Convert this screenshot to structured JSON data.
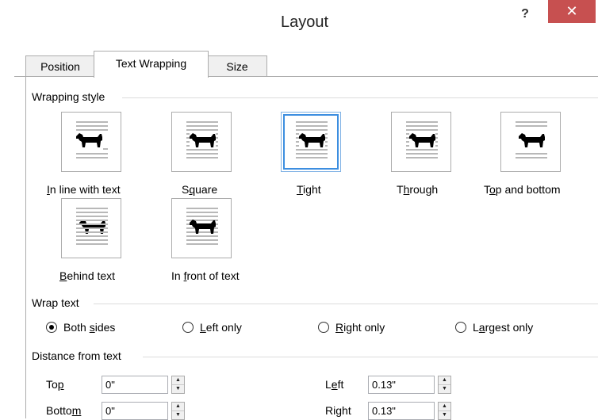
{
  "window": {
    "title": "Layout",
    "help_label": "?",
    "close_label": "✕"
  },
  "tabs": [
    {
      "label": "Position"
    },
    {
      "label": "Text Wrapping",
      "selected": true
    },
    {
      "label": "Size"
    }
  ],
  "wrapping_style": {
    "heading": "Wrapping style",
    "options": [
      {
        "label_pre": "",
        "label_key": "I",
        "label_post": "n line with text",
        "icon": "in-line-with-text-icon"
      },
      {
        "label_pre": "S",
        "label_key": "q",
        "label_post": "uare",
        "icon": "square-wrap-icon"
      },
      {
        "label_pre": "",
        "label_key": "T",
        "label_post": "ight",
        "icon": "tight-wrap-icon",
        "selected": true
      },
      {
        "label_pre": "T",
        "label_key": "h",
        "label_post": "rough",
        "icon": "through-wrap-icon"
      },
      {
        "label_pre": "T",
        "label_key": "o",
        "label_post": "p and bottom",
        "icon": "top-and-bottom-icon"
      },
      {
        "label_pre": "",
        "label_key": "B",
        "label_post": "ehind text",
        "icon": "behind-text-icon"
      },
      {
        "label_pre": "In ",
        "label_key": "f",
        "label_post": "ront of text",
        "icon": "in-front-of-text-icon"
      }
    ]
  },
  "wrap_text": {
    "heading": "Wrap text",
    "options": [
      {
        "label_pre": "Both ",
        "label_key": "s",
        "label_post": "ides",
        "checked": true
      },
      {
        "label_pre": "",
        "label_key": "L",
        "label_post": "eft only",
        "checked": false
      },
      {
        "label_pre": "",
        "label_key": "R",
        "label_post": "ight only",
        "checked": false
      },
      {
        "label_pre": "L",
        "label_key": "a",
        "label_post": "rgest only",
        "checked": false
      }
    ]
  },
  "distance": {
    "heading": "Distance from text",
    "fields": [
      {
        "label_pre": "To",
        "label_key": "p",
        "label_post": "",
        "value": "0\""
      },
      {
        "label_pre": "Botto",
        "label_key": "m",
        "label_post": "",
        "value": "0\""
      },
      {
        "label_pre": "L",
        "label_key": "e",
        "label_post": "ft",
        "value": "0.13\""
      },
      {
        "label_pre": "Ri",
        "label_key": "g",
        "label_post": "ht",
        "value": "0.13\""
      }
    ]
  },
  "colors": {
    "close_bg": "#c75050",
    "selection_border": "#3c8ee0",
    "dog": "#000000",
    "lines": "#b8b8b8"
  }
}
